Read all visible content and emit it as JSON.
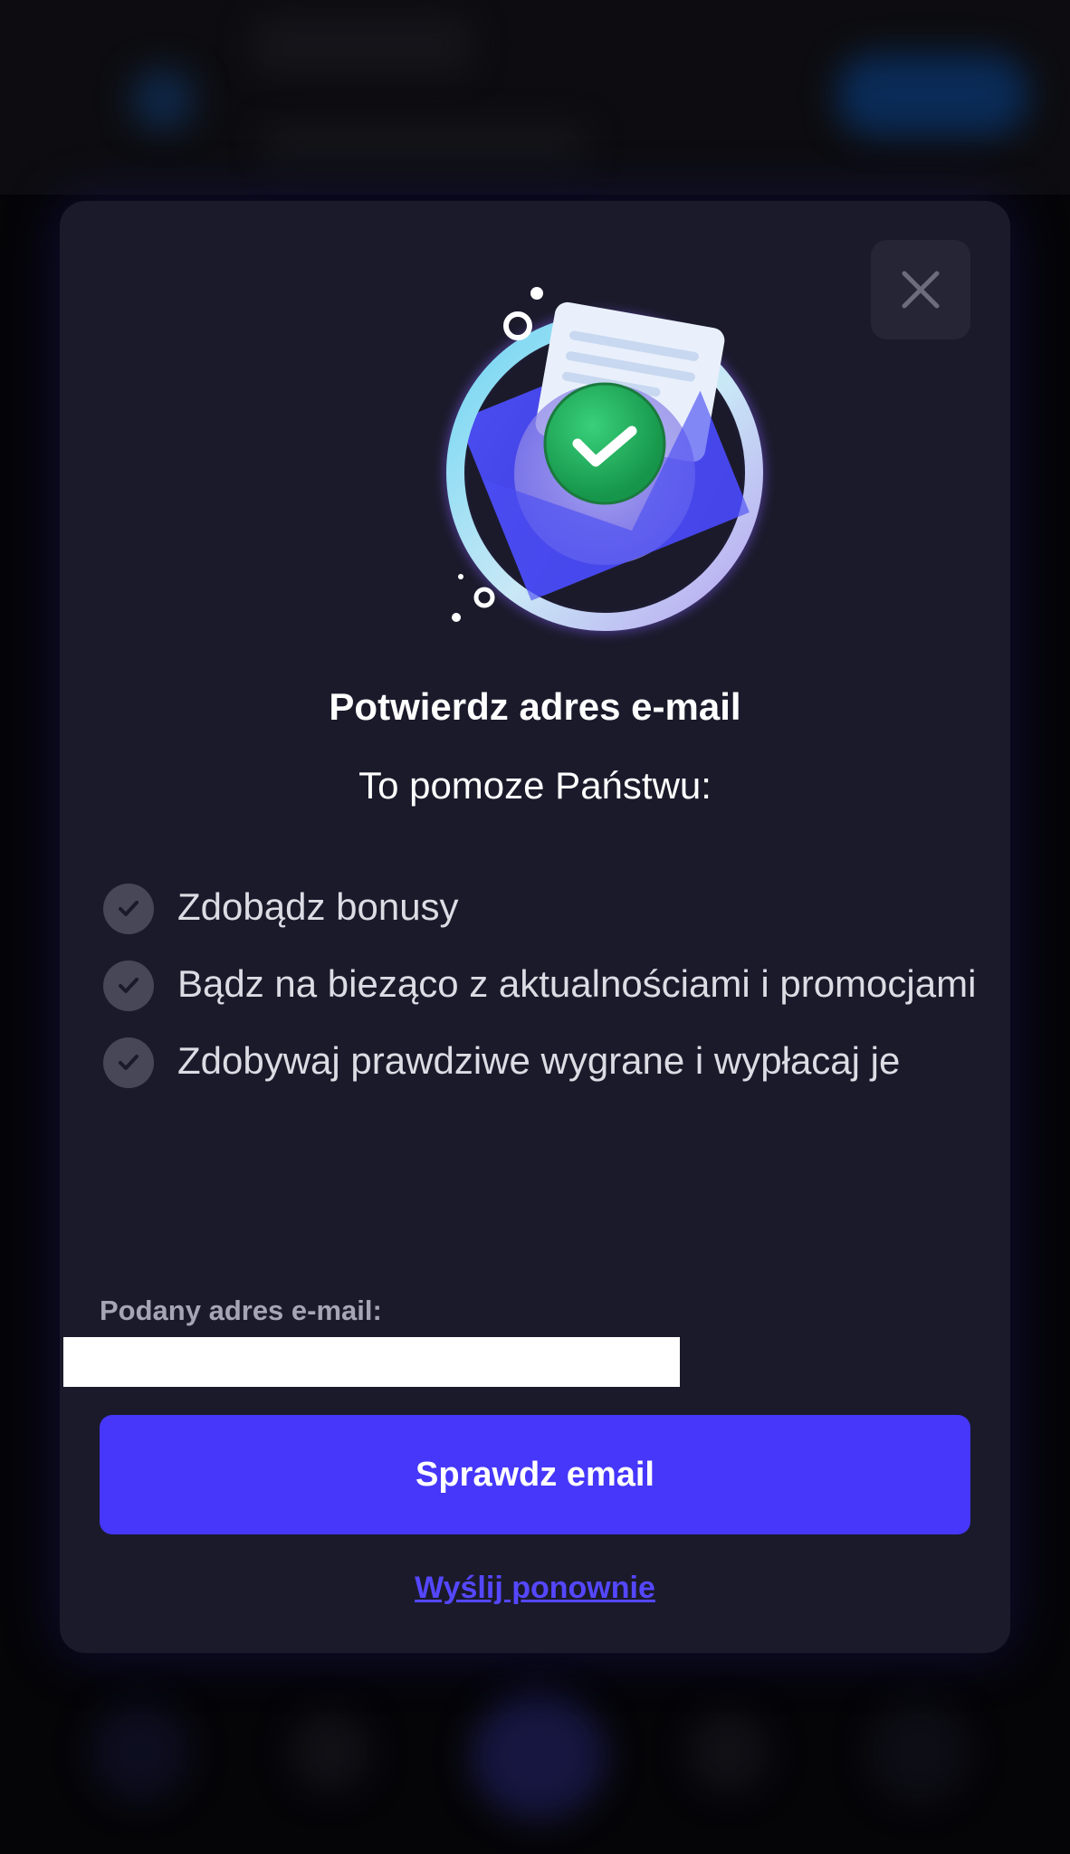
{
  "modal": {
    "title": "Potwierdz adres e-mail",
    "subtitle": "To pomoze Państwu:",
    "benefits": [
      {
        "text": "Zdobądz bonusy",
        "icon": "check-icon"
      },
      {
        "text": "Bądz na bieząco z aktualnościami i promocjami",
        "icon": "check-icon"
      },
      {
        "text": "Zdobywaj prawdziwe wygrane i wypłacaj je",
        "icon": "check-icon"
      }
    ],
    "email_label": "Podany adres e-mail:",
    "email_value": "",
    "primary_button": "Sprawdz email",
    "resend_link": "Wyślij ponownie",
    "close_icon": "close-icon",
    "illustration": "email-verified-illustration"
  },
  "colors": {
    "modal_bg": "#1b1a2b",
    "accent": "#4637fa",
    "link": "#5447ff",
    "check_bg": "#474758",
    "badge_green": "#22b45c"
  }
}
